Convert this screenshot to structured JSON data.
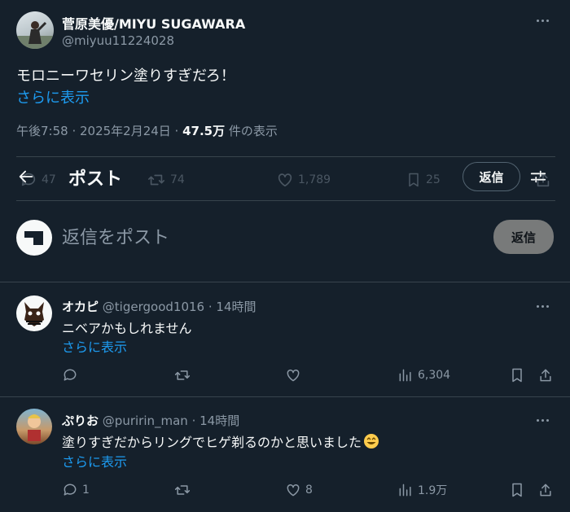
{
  "main_post": {
    "display_name": "菅原美優/MIYU SUGAWARA",
    "handle": "@miyuu11224028",
    "text": "モロニーワセリン塗りすぎだろ！",
    "show_more": "さらに表示",
    "time": "午後7:58 · 2025年2月24日 · ",
    "views_count": "47.5万",
    "views_label": " 件の表示",
    "stats": {
      "replies": "47",
      "reposts": "74",
      "likes": "1,789",
      "bookmarks": "25"
    }
  },
  "sticky_header": {
    "title": "ポスト",
    "reply_button": "返信"
  },
  "composer": {
    "placeholder": "返信をポスト",
    "reply_button": "返信"
  },
  "replies": [
    {
      "display_name": "オカピ",
      "handle": "@tigergood1016",
      "time": "· 14時間",
      "text": "ニベアかもしれません",
      "show_more": "さらに表示",
      "replies": "",
      "reposts": "",
      "likes": "",
      "views": "6,304"
    },
    {
      "display_name": "ぷりお",
      "handle": "@puririn_man",
      "time": "· 14時間",
      "text": "塗りすぎだからリングでヒゲ剃るのかと思いました",
      "show_more": "さらに表示",
      "replies": "1",
      "reposts": "",
      "likes": "8",
      "views": "1.9万"
    }
  ],
  "icons": [
    "more-icon",
    "back-arrow-icon",
    "filter-icon",
    "reply-icon",
    "repost-icon",
    "like-icon",
    "views-icon",
    "bookmark-icon",
    "share-icon",
    "grinning-emoji-icon"
  ],
  "colors": {
    "background": "#15202b",
    "accent": "#1d9bf0",
    "muted": "#8b98a5",
    "divider": "#38444d"
  }
}
